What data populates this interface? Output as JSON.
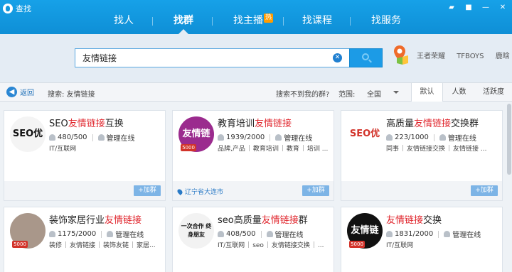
{
  "app": {
    "title": "查找"
  },
  "nav": {
    "items": [
      {
        "label": "找人"
      },
      {
        "label": "找群"
      },
      {
        "label": "找主播",
        "badge": "热"
      },
      {
        "label": "找课程"
      },
      {
        "label": "找服务"
      }
    ],
    "active": "找群"
  },
  "search": {
    "value": "友情链接",
    "placeholder": "",
    "hot_words": [
      "王者荣耀",
      "TFBOYS",
      "鹿晗"
    ]
  },
  "filter": {
    "back_label": "返回",
    "crumb": "搜索: 友情链接",
    "not_found": "搜索不到我的群?",
    "range_label": "范围:",
    "range_value": "全国",
    "sort_tabs": [
      "默认",
      "人数",
      "活跃度"
    ],
    "sort_active": "默认"
  },
  "groups": [
    {
      "name_prefix": "SEO",
      "name_kw": "友情链接",
      "name_suffix": "互换",
      "members": "480/500",
      "manager": "管理在线",
      "tags": [
        "IT/互联网"
      ],
      "avatar_text": "SEO优化",
      "avatar_bg": "#f4f4f4",
      "avatar_fg": "#111",
      "badge": "",
      "location": "",
      "add_label": "+加群"
    },
    {
      "name_prefix": "教育培训",
      "name_kw": "友情链接",
      "name_suffix": "",
      "members": "1939/2000",
      "manager": "管理在线",
      "tags": [
        "品牌,产品",
        "教育培训",
        "教育",
        "培训 ..."
      ],
      "avatar_text": "友情链接",
      "avatar_bg": "#9b2b8e",
      "avatar_fg": "#fff",
      "badge": "5000",
      "location": "辽宁省大连市",
      "add_label": "+加群"
    },
    {
      "name_prefix": "高质量",
      "name_kw": "友情链接",
      "name_suffix": "交换群",
      "members": "223/1000",
      "manager": "管理在线",
      "tags": [
        "同事",
        "友情链接交换",
        "友情链接 ..."
      ],
      "avatar_text": "SEO优化",
      "avatar_bg": "#ffffff",
      "avatar_fg": "#d2332a",
      "badge": "",
      "location": "",
      "add_label": "+加群"
    },
    {
      "name_prefix": "装饰家居行业",
      "name_kw": "友情链接",
      "name_suffix": "",
      "members": "1175/2000",
      "manager": "管理在线",
      "tags": [
        "装修",
        "友情链接",
        "装饰友链",
        "家居..."
      ],
      "avatar_text": "",
      "avatar_bg": "#a9978a",
      "avatar_fg": "#fff",
      "badge": "5000",
      "location": "",
      "add_label": "+加群"
    },
    {
      "name_prefix": "seo高质量",
      "name_kw": "友情链接",
      "name_suffix": "群",
      "members": "408/500",
      "manager": "管理在线",
      "tags": [
        "IT/互联网",
        "seo",
        "友情链接交换",
        "..."
      ],
      "avatar_text": "一次合作 终身朋友",
      "avatar_bg": "#f2f2f2",
      "avatar_fg": "#111",
      "badge": "",
      "location": "",
      "add_label": "+加群"
    },
    {
      "name_prefix": "",
      "name_kw": "友情链接",
      "name_suffix": "交换",
      "members": "1831/2000",
      "manager": "管理在线",
      "tags": [
        "IT/互联网"
      ],
      "avatar_text": "友情链接",
      "avatar_bg": "#111111",
      "avatar_fg": "#fff",
      "badge": "5000",
      "location": "",
      "add_label": "+加群"
    }
  ]
}
